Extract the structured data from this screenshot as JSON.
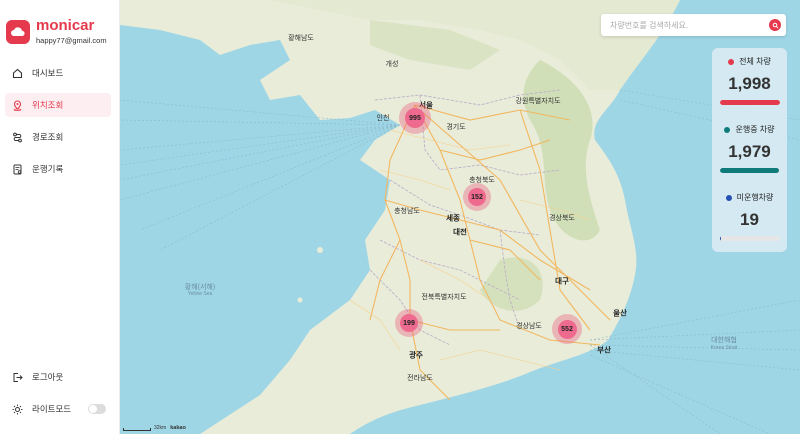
{
  "app": {
    "name": "monicar",
    "email": "happy77@gmail.com"
  },
  "nav": {
    "items": [
      {
        "label": "대시보드",
        "icon": "home-icon",
        "active": false
      },
      {
        "label": "위치조회",
        "icon": "map-pin-icon",
        "active": true
      },
      {
        "label": "경로조회",
        "icon": "route-icon",
        "active": false
      },
      {
        "label": "운행기록",
        "icon": "log-icon",
        "active": false
      }
    ],
    "logout_label": "로그아웃",
    "lightmode_label": "라이트모드"
  },
  "search": {
    "placeholder": "차량번호를 검색하세요."
  },
  "stats": {
    "total": {
      "label": "전체 차량",
      "value": "1,998",
      "color": "#e5394d",
      "fill": 1.0
    },
    "running": {
      "label": "운행중 차량",
      "value": "1,979",
      "color": "#0f7a7a",
      "fill": 0.99
    },
    "idle": {
      "label": "미운행차량",
      "value": "19",
      "color": "#2450b4",
      "fill": 0.01
    }
  },
  "clusters": [
    {
      "count": "995"
    },
    {
      "count": "152"
    },
    {
      "count": "199"
    },
    {
      "count": "552"
    }
  ],
  "map": {
    "labels": {
      "seoul": "서울",
      "gyeonggi": "경기도",
      "gangwon": "강원특별자치도",
      "chungbuk": "충청북도",
      "chungnam": "충청남도",
      "gyeongbuk": "경상북도",
      "jeonbuk": "전북특별자치도",
      "gyeongnam": "경상남도",
      "jeonnam": "전라남도",
      "daejeon": "대전",
      "sejong": "세종",
      "daegu": "대구",
      "gwangju": "광주",
      "ulsan": "울산",
      "busan": "부산",
      "yellow_sea": "황해(서해)",
      "yellow_sea_en": "Yellow Sea",
      "korea_strait": "대한해협",
      "korea_strait_en": "Korea Strait",
      "hwanghae": "황해남도",
      "gaeseong": "개성",
      "incheon": "인천"
    },
    "scale_label": "32km",
    "attribution": "kakao"
  }
}
